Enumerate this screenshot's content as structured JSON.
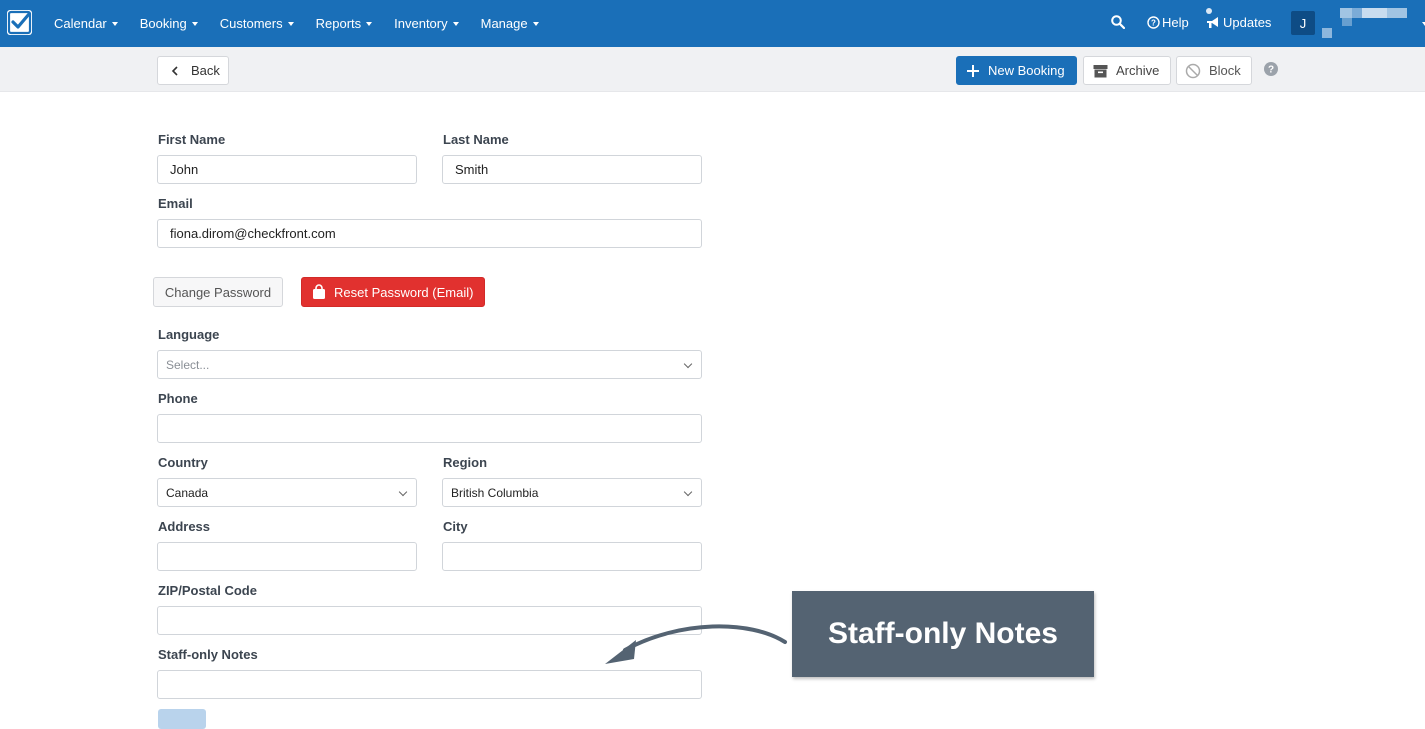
{
  "nav": {
    "menu": [
      {
        "label": "Calendar"
      },
      {
        "label": "Booking"
      },
      {
        "label": "Customers"
      },
      {
        "label": "Reports"
      },
      {
        "label": "Inventory"
      },
      {
        "label": "Manage"
      }
    ],
    "help_label": "Help",
    "updates_label": "Updates",
    "avatar_initial": "J"
  },
  "toolbar": {
    "back_label": "Back",
    "new_booking_label": "New Booking",
    "archive_label": "Archive",
    "block_label": "Block"
  },
  "form": {
    "first_name": {
      "label": "First Name",
      "value": "John"
    },
    "last_name": {
      "label": "Last Name",
      "value": "Smith"
    },
    "email": {
      "label": "Email",
      "value": "fiona.dirom@checkfront.com"
    },
    "change_password_label": "Change Password",
    "reset_password_label": "Reset Password (Email)",
    "language": {
      "label": "Language",
      "placeholder": "Select..."
    },
    "phone": {
      "label": "Phone",
      "value": ""
    },
    "country": {
      "label": "Country",
      "value": "Canada"
    },
    "region": {
      "label": "Region",
      "value": "British Columbia"
    },
    "address": {
      "label": "Address",
      "value": ""
    },
    "city": {
      "label": "City",
      "value": ""
    },
    "zip": {
      "label": "ZIP/Postal Code",
      "value": ""
    },
    "staff_notes": {
      "label": "Staff-only Notes",
      "value": ""
    }
  },
  "annotation": {
    "callout_text": "Staff-only Notes"
  },
  "colors": {
    "navbar": "#1a6fb8",
    "primary": "#1a6fb8",
    "danger": "#e1312f",
    "callout": "#546372"
  }
}
